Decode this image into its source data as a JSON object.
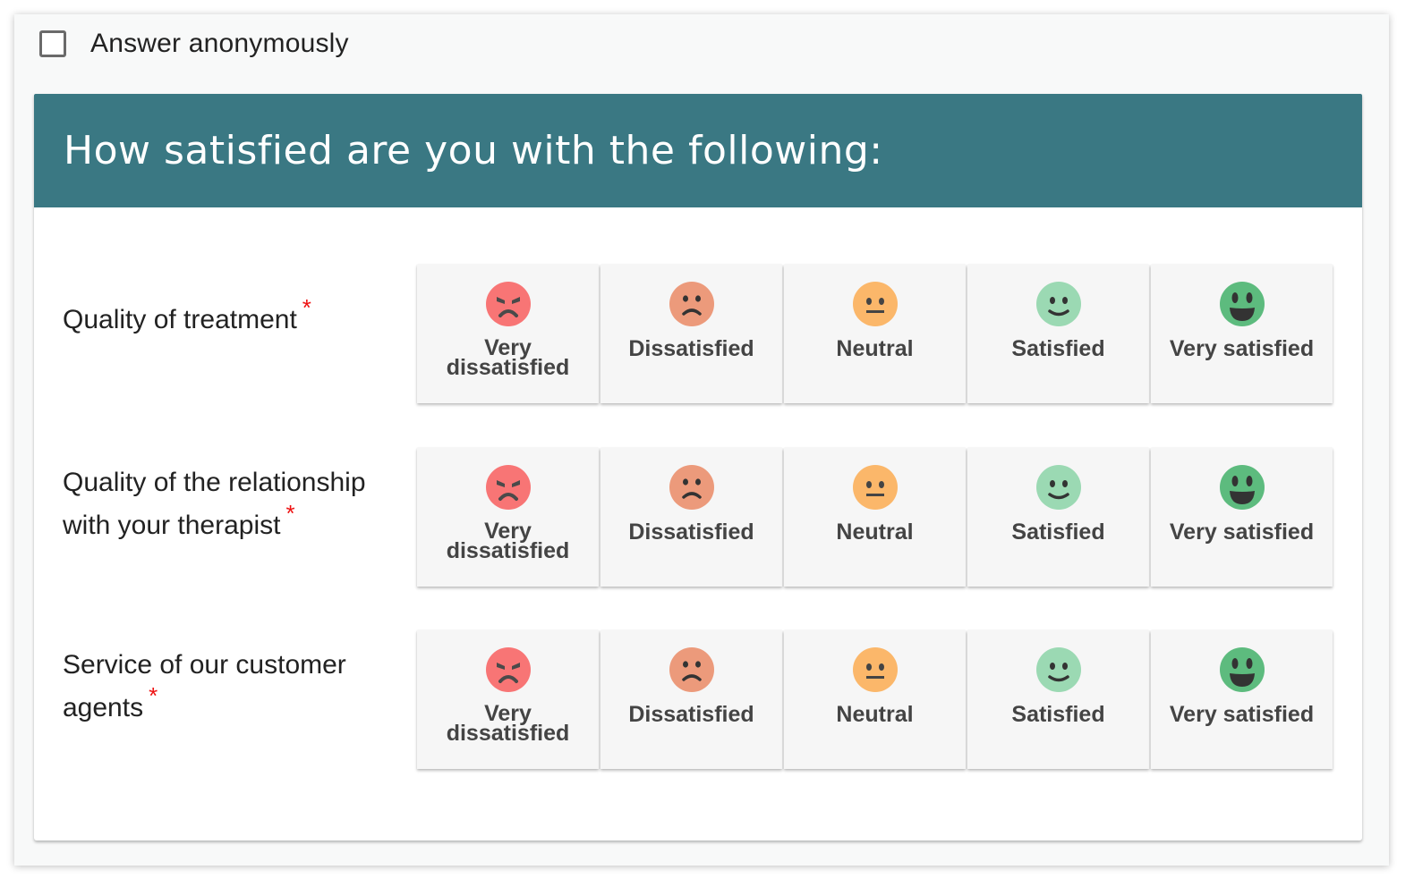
{
  "anonymous": {
    "label": "Answer anonymously",
    "checked": false
  },
  "panel": {
    "title": "How satisfied are you with the following:"
  },
  "colors": {
    "header": "#3a7883",
    "required": "#ee1111",
    "very_dissatisfied": "#f87575",
    "dissatisfied": "#ec9a7b",
    "neutral": "#fbb76a",
    "satisfied": "#9bd9b3",
    "very_satisfied": "#5dbb7e"
  },
  "scale": [
    {
      "label_line1": "Very",
      "label_line2": "dissatisfied",
      "icon": "angry-face-icon"
    },
    {
      "label_line1": "Dissatisfied",
      "label_line2": "",
      "icon": "frown-face-icon"
    },
    {
      "label_line1": "Neutral",
      "label_line2": "",
      "icon": "neutral-face-icon"
    },
    {
      "label_line1": "Satisfied",
      "label_line2": "",
      "icon": "smile-face-icon"
    },
    {
      "label_line1": "Very satisfied",
      "label_line2": "",
      "icon": "grin-face-icon"
    }
  ],
  "questions": [
    {
      "line1": "Quality of treatment",
      "line2": "",
      "required_mark": "*"
    },
    {
      "line1": "Quality of the relationship",
      "line2": "with your therapist",
      "required_mark": "*"
    },
    {
      "line1": "Service of our customer",
      "line2": "agents",
      "required_mark": "*"
    }
  ]
}
